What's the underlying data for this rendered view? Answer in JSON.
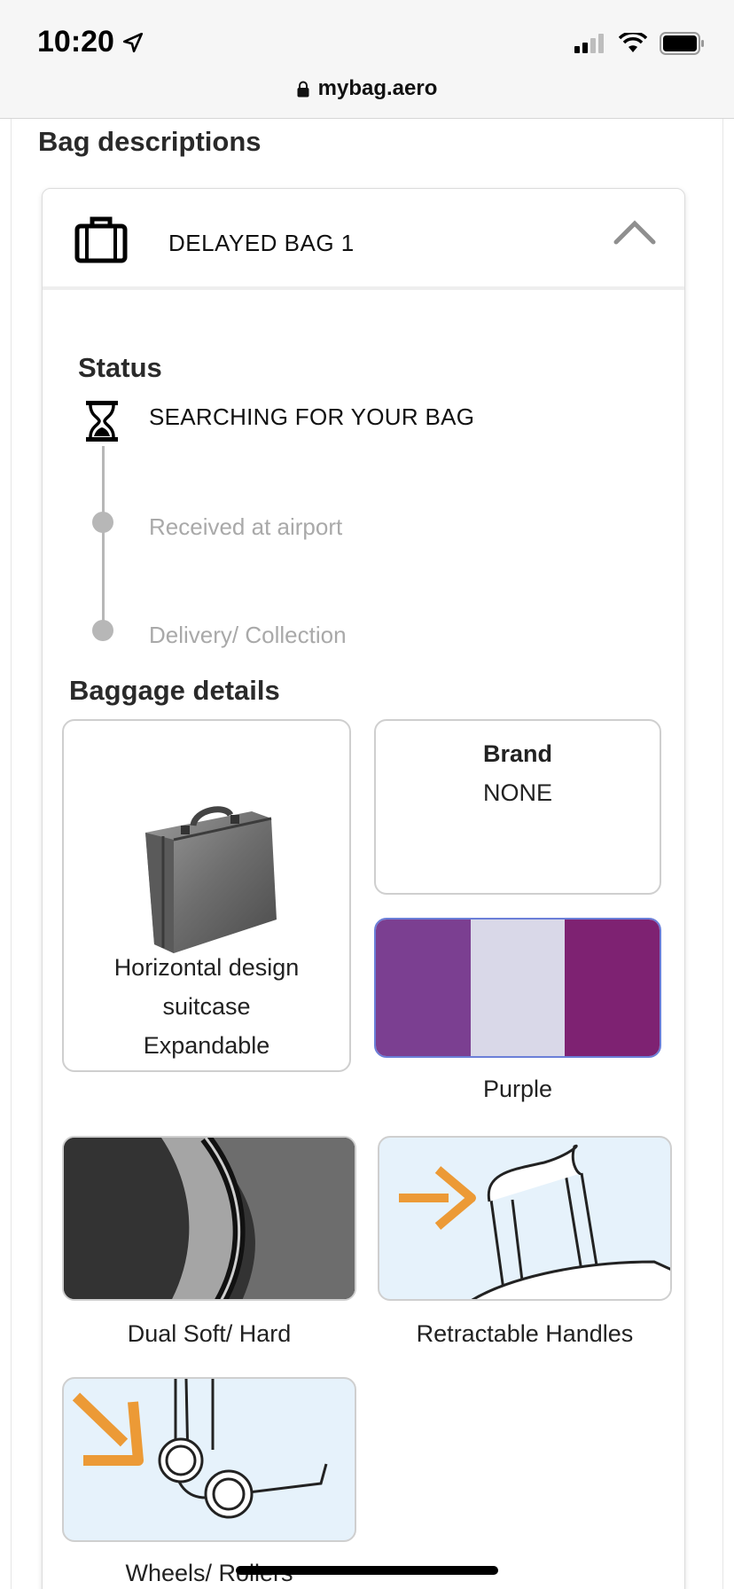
{
  "status_bar": {
    "time": "10:20",
    "icons": [
      "location-arrow-icon",
      "cellular-signal-icon",
      "wifi-icon",
      "battery-icon"
    ]
  },
  "browser": {
    "url": "mybag.aero",
    "lock_icon": "lock-icon"
  },
  "page": {
    "section_title": "Bag descriptions"
  },
  "bag_card": {
    "title": "DELAYED BAG 1",
    "icon": "suitcase-icon",
    "toggle_icon": "chevron-up-icon"
  },
  "status": {
    "label": "Status",
    "steps": [
      {
        "text": "SEARCHING FOR YOUR BAG",
        "icon": "hourglass-icon",
        "state": "active"
      },
      {
        "text": "Received at airport",
        "state": "pending"
      },
      {
        "text": "Delivery/ Collection",
        "state": "pending"
      }
    ]
  },
  "baggage_details": {
    "label": "Baggage details",
    "type": {
      "line1": "Horizontal design",
      "line2": "suitcase",
      "line3": "Expandable"
    },
    "brand": {
      "label": "Brand",
      "value": "NONE"
    },
    "color": {
      "name": "Purple",
      "swatches": [
        "#7b3f91",
        "#d9d8e8",
        "#7e2272"
      ]
    },
    "features": [
      {
        "label": "Dual Soft/ Hard"
      },
      {
        "label": "Retractable Handles"
      },
      {
        "label": "Wheels/ Rollers"
      }
    ],
    "accent_color": "#ec9a36"
  }
}
